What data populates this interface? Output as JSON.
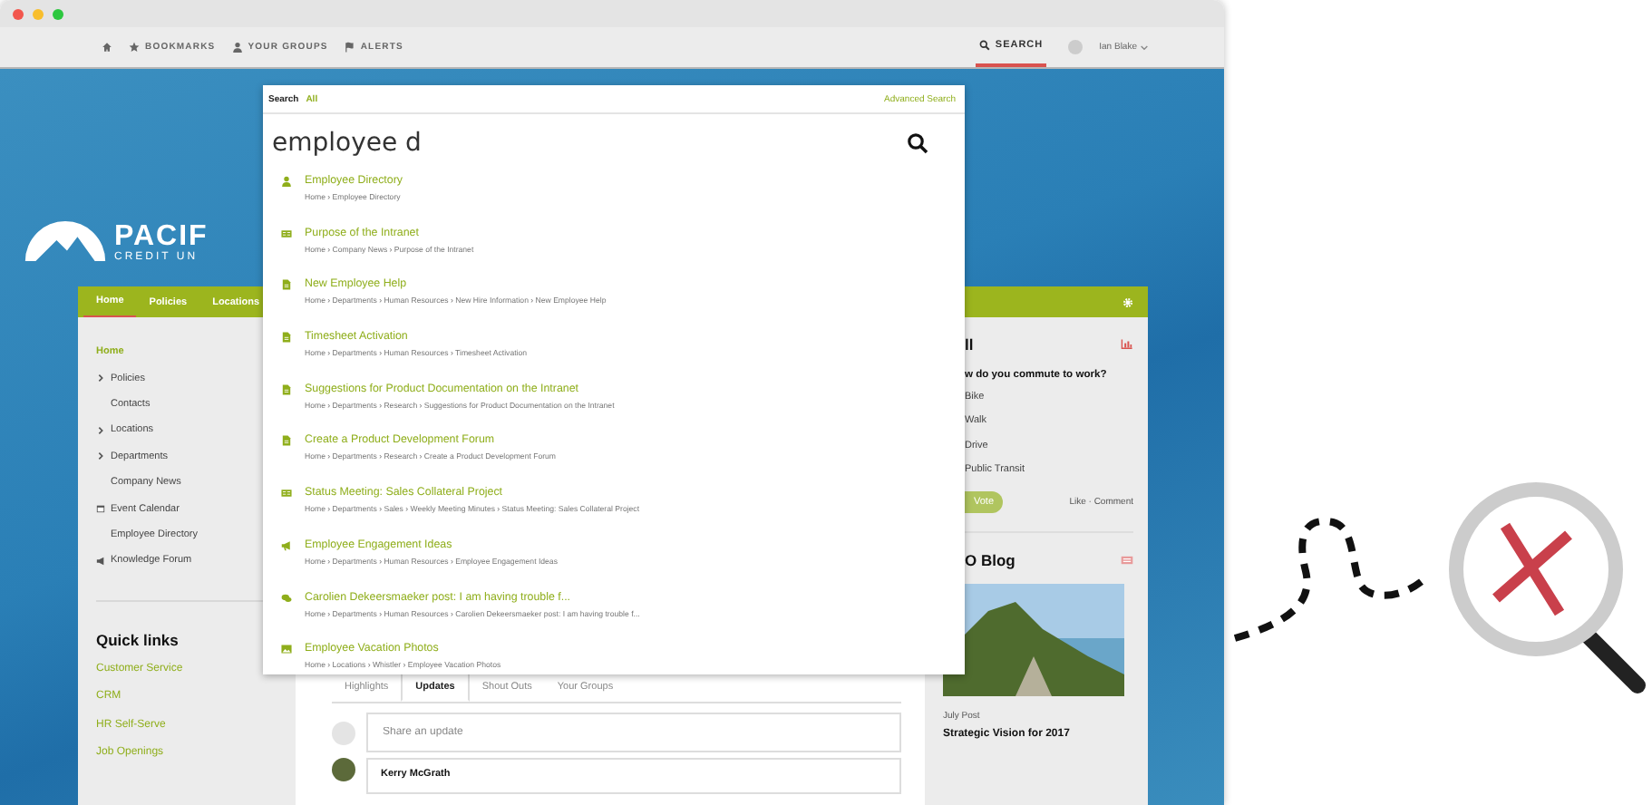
{
  "topbar": {
    "links": [
      {
        "kind": "home"
      },
      {
        "kind": "star",
        "label": "BOOKMARKS"
      },
      {
        "kind": "user",
        "label": "YOUR GROUPS"
      },
      {
        "kind": "flag",
        "label": "ALERTS"
      }
    ],
    "search": {
      "label": "SEARCH",
      "selected": true
    },
    "user": "Ian Blake"
  },
  "logo": {
    "name": "PACIF",
    "subtitle": "CREDIT UN"
  },
  "main_nav": [
    {
      "label": "Home",
      "selected": true
    },
    {
      "label": "Policies",
      "selected": false
    },
    {
      "label": "Locations",
      "selected": false
    }
  ],
  "sidebar": {
    "items": [
      {
        "label": "Home",
        "kind": "page",
        "selected": true
      },
      {
        "label": "Policies",
        "kind": "folder",
        "expanded": false,
        "selected": false
      },
      {
        "label": "Contacts",
        "kind": "page",
        "selected": false
      },
      {
        "label": "Locations",
        "kind": "folder",
        "expanded": false,
        "selected": false
      },
      {
        "label": "Departments",
        "kind": "folder",
        "expanded": false,
        "selected": false
      },
      {
        "label": "Company News",
        "kind": "page",
        "selected": false
      },
      {
        "label": "Event Calendar",
        "kind": "calendar",
        "selected": false
      },
      {
        "label": "Employee Directory",
        "kind": "page",
        "selected": false
      },
      {
        "label": "Knowledge Forum",
        "kind": "forum",
        "selected": false
      }
    ],
    "quick_links": {
      "title": "Quick links",
      "items": [
        "Customer Service",
        "CRM",
        "HR Self-Serve",
        "Job Openings"
      ]
    }
  },
  "search": {
    "label": "Search",
    "scope": "All",
    "advanced": "Advanced Search",
    "query": "employee d",
    "results": [
      {
        "kind": "person",
        "title": "Employee Directory",
        "path": "Home › Employee Directory"
      },
      {
        "kind": "news",
        "title": "Purpose of the Intranet",
        "path": "Home › Company News › Purpose of the Intranet"
      },
      {
        "kind": "document",
        "title": "New Employee Help",
        "path": "Home › Departments › Human Resources › New Hire Information › New Employee Help"
      },
      {
        "kind": "document",
        "title": "Timesheet Activation",
        "path": "Home › Departments › Human Resources › Timesheet Activation"
      },
      {
        "kind": "document",
        "title": "Suggestions for Product Documentation on the Intranet",
        "path": "Home › Departments › Research › Suggestions for Product Documentation on the Intranet"
      },
      {
        "kind": "document",
        "title": "Create a Product Development Forum",
        "path": "Home › Departments › Research › Create a Product Development Forum"
      },
      {
        "kind": "news",
        "title": "Status Meeting: Sales Collateral Project",
        "path": "Home › Departments › Sales › Weekly Meeting Minutes › Status Meeting: Sales Collateral Project"
      },
      {
        "kind": "announcement",
        "title": "Employee Engagement Ideas",
        "path": "Home › Departments › Human Resources › Employee Engagement Ideas"
      },
      {
        "kind": "discussion",
        "title": "Carolien Dekeersmaeker post: I am having trouble f...",
        "path": "Home › Departments › Human Resources › Carolien Dekeersmaeker post: I am having trouble f..."
      },
      {
        "kind": "photo",
        "title": "Employee Vacation Photos",
        "path": "Home › Locations › Whistler › Employee Vacation Photos"
      }
    ]
  },
  "feed": {
    "tabs": [
      {
        "label": "Highlights",
        "selected": false
      },
      {
        "label": "Updates",
        "selected": true
      },
      {
        "label": "Shout Outs",
        "selected": false
      },
      {
        "label": "Your Groups",
        "selected": false
      }
    ],
    "share": {
      "placeholder": "Share an update"
    },
    "post_author": "Kerry McGrath"
  },
  "poll": {
    "title": "ll",
    "question": "w do you commute to work?",
    "options": [
      "Bike",
      "Walk",
      "Drive",
      "Public Transit"
    ],
    "vote": "Vote",
    "actions": "Like · Comment"
  },
  "blog": {
    "title": "O Blog",
    "post_label": "July Post",
    "post_title": "Strategic Vision for 2017"
  }
}
